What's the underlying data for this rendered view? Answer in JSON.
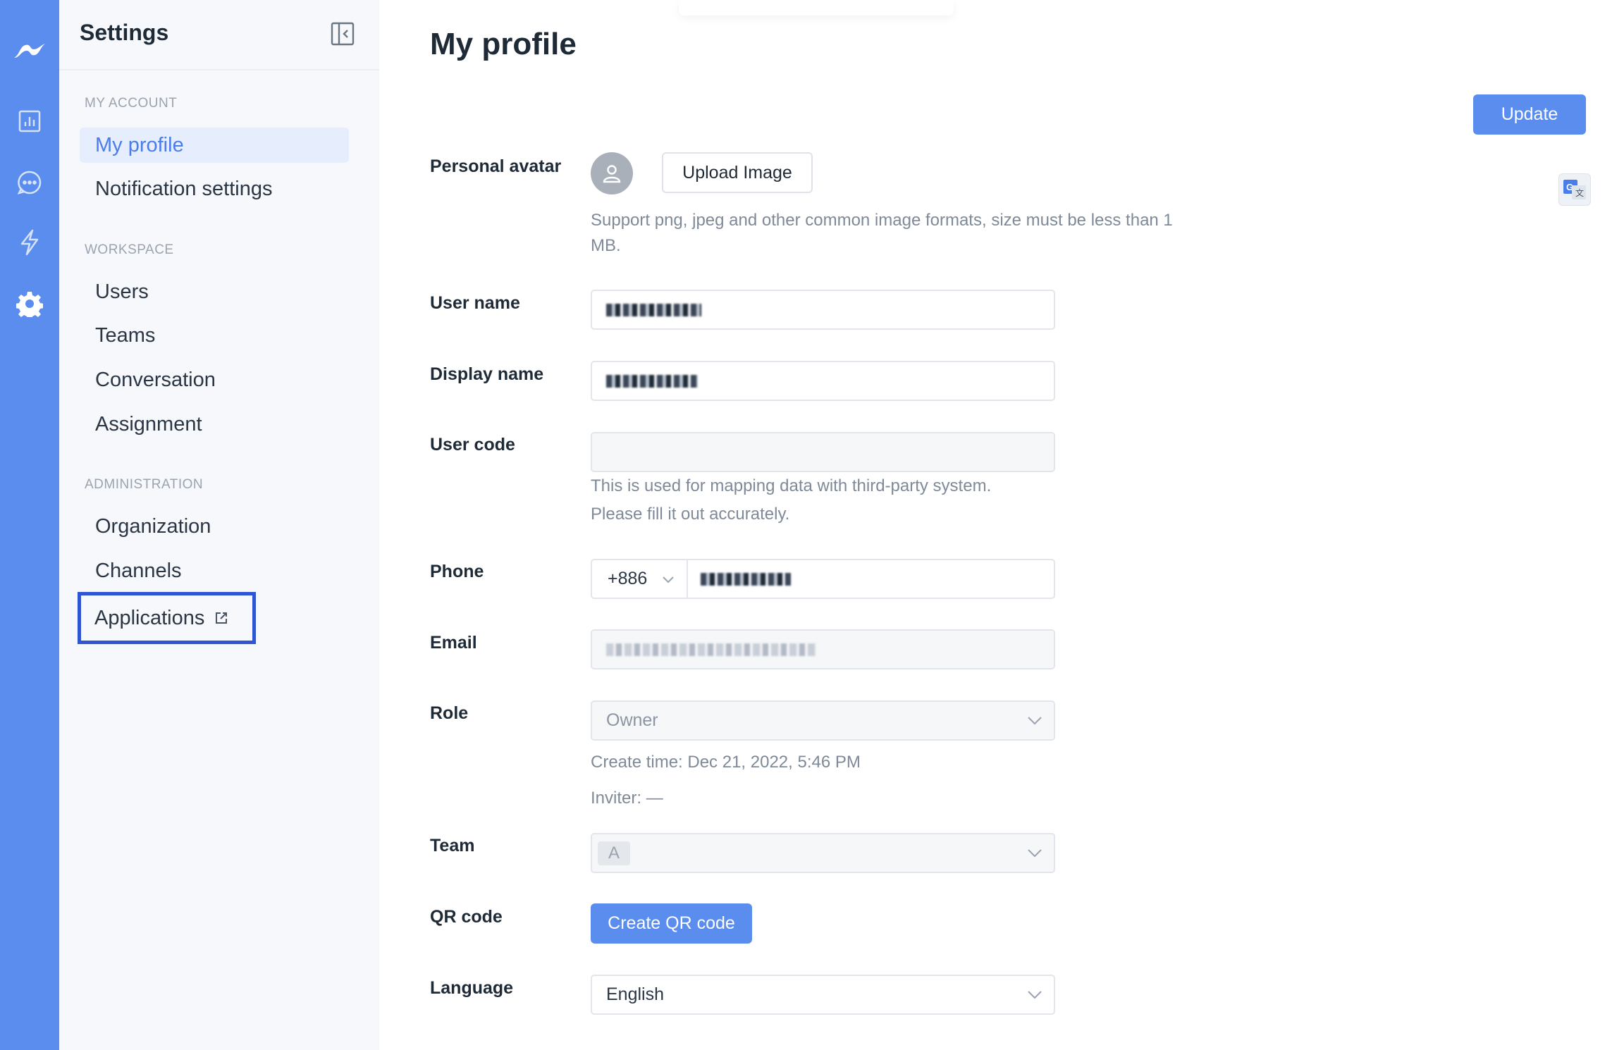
{
  "rail": {
    "icons": [
      "logo-icon",
      "analytics-icon",
      "chat-icon",
      "automation-icon",
      "settings-icon"
    ]
  },
  "sidebar": {
    "title": "Settings",
    "sections": [
      {
        "label": "MY ACCOUNT",
        "items": [
          "My profile",
          "Notification settings"
        ]
      },
      {
        "label": "WORKSPACE",
        "items": [
          "Users",
          "Teams",
          "Conversation",
          "Assignment"
        ]
      },
      {
        "label": "ADMINISTRATION",
        "items": [
          "Organization",
          "Channels",
          "Applications"
        ]
      }
    ],
    "active_item": "My profile"
  },
  "main": {
    "title": "My profile",
    "update_label": "Update",
    "avatar": {
      "label": "Personal avatar",
      "upload_label": "Upload Image",
      "hint_line1": "Support png, jpeg and other common image formats, size must be less than 1",
      "hint_line2": "MB."
    },
    "user_name": {
      "label": "User name"
    },
    "display_name": {
      "label": "Display name"
    },
    "user_code": {
      "label": "User code",
      "value": "",
      "hint_line1": "This is used for mapping data with third-party system.",
      "hint_line2": "Please fill it out accurately."
    },
    "phone": {
      "label": "Phone",
      "country_code": "+886"
    },
    "email": {
      "label": "Email"
    },
    "role": {
      "label": "Role",
      "value": "Owner",
      "create_time": "Create time: Dec 21, 2022, 5:46 PM",
      "inviter": "Inviter: —"
    },
    "team": {
      "label": "Team",
      "tag": "A"
    },
    "qr_code": {
      "label": "QR code",
      "button_label": "Create QR code"
    },
    "language": {
      "label": "Language",
      "value": "English"
    }
  },
  "colors": {
    "rail": "#5b8def",
    "accent": "#5b8def",
    "active_bg": "#e6edfd",
    "highlight_border": "#2f55d4"
  }
}
